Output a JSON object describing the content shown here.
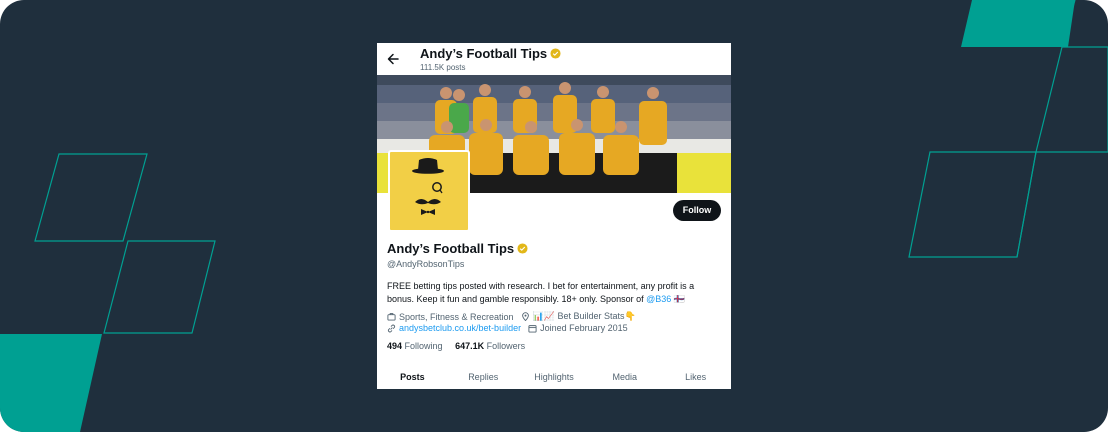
{
  "header": {
    "title": "Andy’s Football Tips",
    "posts": "111.5K posts"
  },
  "profile": {
    "name": "Andy’s Football Tips",
    "handle": "@AndyRobsonTips",
    "follow_label": "Follow",
    "bio_line1": "FREE betting tips posted with research. I bet for entertainment, any profit is a",
    "bio_line2_prefix": "bonus. Keep it fun and gamble responsibly. 18+ only. Sponsor of ",
    "bio_mention": "@B36",
    "bio_flag": "🇫🇴",
    "category": "Sports, Fitness & Recreation",
    "location": "📊📈 Bet Builder Stats👇",
    "website": "andysbetclub.co.uk/bet-builder",
    "joined": "Joined February 2015",
    "following_count": "494",
    "following_label": "Following",
    "followers_count": "647.1K",
    "followers_label": "Followers"
  },
  "tabs": [
    "Posts",
    "Replies",
    "Highlights",
    "Media",
    "Likes"
  ],
  "colors": {
    "background": "#1f2f3d",
    "accent_teal": "#00a092",
    "link_blue": "#1d9bf0",
    "avatar_yellow": "#f2cf46",
    "verified_gold": "#e2b719"
  },
  "icons": {
    "back": "arrow-left-icon",
    "category": "briefcase-icon",
    "location": "location-pin-icon",
    "website": "link-icon",
    "joined": "calendar-icon",
    "verified": "verified-badge-icon"
  }
}
